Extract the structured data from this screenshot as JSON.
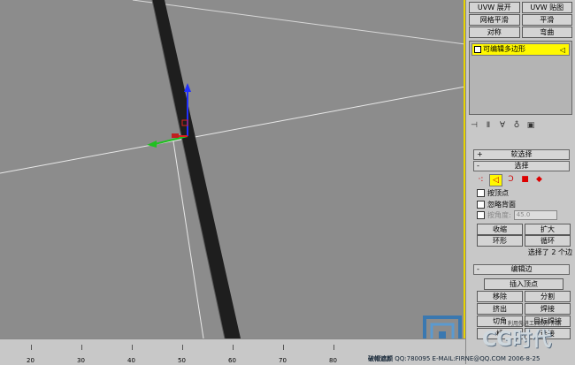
{
  "modifiers": {
    "row1": [
      "UVW 展开",
      "UVW 贴图"
    ],
    "row2": [
      "网格平滑",
      "平滑"
    ],
    "row3": [
      "对称",
      "弯曲"
    ]
  },
  "stack": {
    "item": "可编辑多边形"
  },
  "rollouts": {
    "soft_select": "软选择",
    "select": "选择",
    "edit_edges": "编辑边"
  },
  "select": {
    "by_vertex": "按顶点",
    "ignore_backface": "忽略背面",
    "by_angle": "按角度:",
    "angle_value": "45.0",
    "shrink": "收缩",
    "grow": "扩大",
    "ring": "环形",
    "loop": "循环",
    "status": "选择了 2 个边"
  },
  "edit_edges": {
    "insert_vertex": "插入顶点",
    "remove": "移除",
    "split": "分割",
    "extrude": "挤出",
    "weld": "焊接",
    "chamfer": "切角",
    "target_weld": "目标焊接",
    "bridge": "桥",
    "connect": "连接"
  },
  "ruler": {
    "ticks": [
      "20",
      "30",
      "40",
      "50",
      "60",
      "70",
      "80"
    ]
  },
  "footer": {
    "author": "破帽遮颜",
    "contact": "QQ:780095 E-MAIL:FIRNE@QQ.COM",
    "date": "2006-8-25",
    "logo_text": "CG时代",
    "logo_sub": "利用先进工具制作作品"
  },
  "colors": {
    "accent": "#fff800",
    "viewport": "#8c8c8c",
    "panel": "#c8c8c8"
  }
}
